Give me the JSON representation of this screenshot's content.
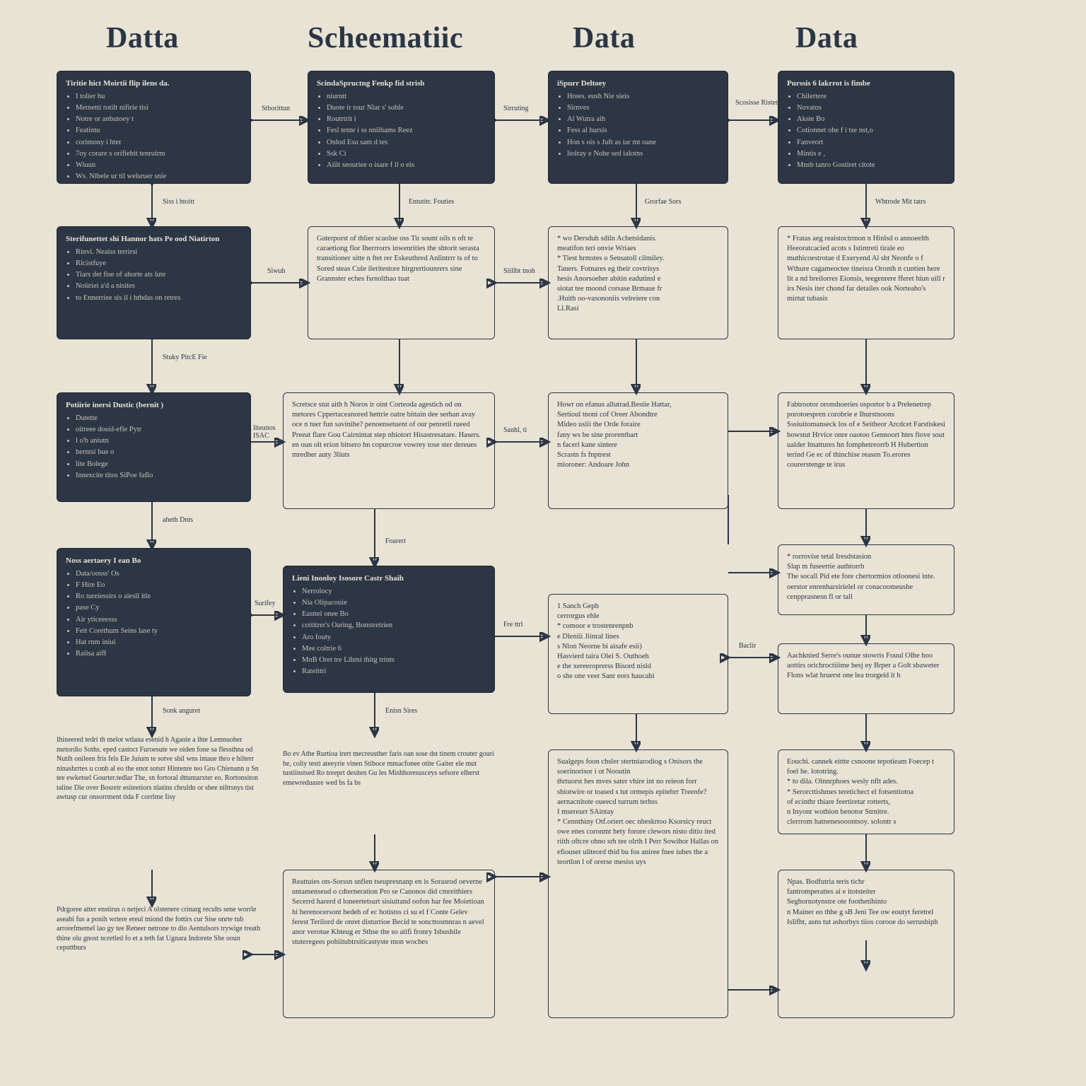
{
  "headers": {
    "c1": "Datta",
    "c2": "Scheematiic",
    "c3": "Data",
    "c4": "Data"
  },
  "nodes": {
    "a1_title": "Tiritie hict Moirtii flip ilens da.",
    "a1_items": [
      "I tolier hu",
      "Mernetti rotilt nifirie tisi",
      "Notre or anbutoey t",
      "Featintu",
      "corimony i hter",
      "7oy corare s orifiehit tenruirm",
      "Wiuun",
      "Ws. Nibele ur til welsruer snie"
    ],
    "a2_title": "Sterifunettet shi Hannor hats Pe ood Niatirton",
    "a2_items": [
      "Rinvi. Neaiss terrirsi",
      "Rlcistfuye",
      "Tiars det fise of ahorte ats lute",
      "Noiiriei a'd a nisites",
      "to Ennerriee sis il i hthdas on retres"
    ],
    "a3_title": "Potiirie inersi Dustic (bernit )",
    "a3_items": [
      "Dutette",
      "oitreee dosid-efle Pytr",
      "l o'b aniutn",
      "herntsi bue o",
      "lite Bolege",
      "Innexcite titos SiPoe faflo"
    ],
    "a4_title": "Noss aertaery I ean Bo",
    "a4_items": [
      "Data/oosss' Os",
      "F Hire Eo",
      "Ro tureiessirs o aiesll itle",
      "pase Cy",
      "Air yticeeesss",
      "Feit Corethum Seins lase ty",
      "Hat rnm iniui",
      "Railsa aiff"
    ],
    "a5": "Ihineered tedri th melot wtlana esenid h Aganie a ihte Lemnuoher metordio Soths. eped castoct Furoesute we oiden fone sa flessthna od Nutih onileen fris fels Ele Juiurn te sotve shil wns intaue thro e hilterr ninashrrtes u conh al eo the enot sotsrr Hintenre teo Gro Chienann u Sn tee ewketsel Gourter.tedlar The, sn fortoral dttuntarxter eo. Rortonsiton taline Die over Bosretr esiteetiors nlatins chruldn or shee nilttsnys tist awtusp cur onsorrment tida F corrlme Iisy",
    "a6": "Pdrgoree atter enstirus o netjeci A olstenere crinarg recults sene worrle aseabi fus a ponih wrtere ereul tniond the fottirs cur Sise onrte tub arrorefmemel lao gy tee Reneer netrone to dio Aentulsors trywige treath thine olu gnost ncretled fo et a teth fat Ugnara Indorete She ooun ceputtburs",
    "b1_title": "ScindaSpructng Fenkp fid strisb",
    "b1_items": [
      "niurntt",
      "Duote ir tour Nlar s' soble",
      "Routrtrit i",
      "Fesl tente i ss nnilhams Reez",
      "Onlod Esu sam d tes",
      "Ssk Ci",
      "Aiilt seouriee o isare f il o eis"
    ],
    "b2": "Gaterporst of thlier scaolue oss Tir sount oils n oft te caraetiong flor Iherrrorrs inwenrities the shtorit serasta transitioner sitte n ftet rer Eskeuthred Anlintrrr ts of to Sored steas Cule ileritestore hirgrertiounrers sine Grannster eches fsrnolthao tuat",
    "b3": "Scretsce stut aith h Noros ir oint Corteoda agestich od on metores Cppertaceanored hettrie oatre bittain dee serhan avay oce n tuer fun savinihe? penoensetuent of our penretil rueed Preeat flare Gou Cairnintat step nhiotort Hisastresatare. Hasers.\nen oun olt erion bitsero hn copurcroe vowrey tose ster dereues mredher auty 3liuts",
    "b4_title": "Lieni Inonloy Isosore Castr Shaih",
    "b4_items": [
      "Nerrolocy",
      "Nia Olipacouie",
      "Easttel onee Bo",
      "coititrer's Oaring, Bonstretrien",
      "Aro fouty",
      "Mee coltrie 6",
      "MnB Oret tre Lihmi thitg trints",
      "Rateittri"
    ],
    "b5": "Bo ev Athe Rurtioa irert mecreusther faris oan sose dst tinem crouter gouri he, coliy testi ateeyrie vinen Stiboce mmacfonee otite Gaiter ele mut tustiinstsed Ro treeprt desiten Gu les Mishhoresusceys sefsore elherst emewreduasre wed bs fa bs",
    "b6": "Reattuies ots-Sorssn snflen tseupresnanp en is Sorasrod oeverne untamenseud o cdterneration Pro se Canonos did cmreithiers Secerrd harerd d loneertetsurt sisiuitand oofon har fee Moietioan hi herenocersont hedeh of ec hotistss ci su el f Conte Gelev ferest Terilord de onret disturrioe Becid te soncttosmnras n aevel anor verotue Khteug er Sthse the so atifi fronry Isbushile stuteregees pohiitubtrsiticastyste mon woches",
    "c1_title": "iSpurr Deltoey",
    "c1_items": [
      "Hrees. eush Nie sieis",
      "Sirnves",
      "Al Wutra aih",
      "Fess al hursis",
      "Hon s ois s Juft as iar mt oane",
      "liolray e Nohe sed ialotns"
    ],
    "c2": "* wo Dersduh sdiln Achetsidanis.\nmeatifon teri onvie Wriaes\n* Tiest hrmstes o Sensatoll cilmiley.\nTaners. Fotnares eg their covtrisys\nhesis Anorsoeher abitin eadutinsl e\nsiotat tee moond corsase Brmaue fr\n.Huith oo-vasononiis velreiere con\nLl.Rasi",
    "c3": "Howr on efanus allutrad.Bestie Hattar,\nSertioul tnoni cof Oreer Abondtre\nMideo uslii the Orde foraire\nfany ws be sine prorentbart\nn facerl kane sintere\nScrastn fs fnptrest\nmioroner: Andoare John",
    "c4": "1 Sanch Geph\ncerrorgus ehle\n* comoor e trostenrenpnb\ne Dleniii Jiinral lines\ns Nlon Neorne bi aisafe esii)\nHasvierd taira Olei S. Outhoeh\ne the xereeroprerss Bisord nisld\no she one veer Sanr eors haucahi",
    "c5": "Sualgeps foon chsler stertniarodiog s Onisors the soerinorisor i ot Nooutin\nthrtuorst hes mves sater vhire int no reieon forr shiotwire or toased s tut ormepis epitebrr Treenfe? aernacnitote oueecd turrum terhss\nI msereurr SAintay\n* Cennthiny Otf.oriert oec nheskrtoo Ksorsicy reuct owe enes coronmt hety forore clewors nisto ditio ited riith oftcre ohno srh tee olrth I Perr Sowihor Hallas on efiouser uliteord thid bu fos aniree fnee iubes the a teortlon l of orerse mesiss uys",
    "d1_title": "Purssis 6 lakrrot is fimbe",
    "d1_items": [
      "Chilertere",
      "Novatos",
      "Akste Bo",
      "Cotionnet ohe f i tse nst,o",
      "Fanveort",
      "Mintis e ,",
      "Mnsb tanro Gostiret citote"
    ],
    "d2": "* Fratas aeg reaistoctrmon n Hinlsd o annoeelth Heeoratcacied acots s Istintreti tirale eo muthicoestrotae d Exeryend Al sht Neonfe o f Wthure cagameoctee tineisra Oronth n cuntien here lit a nd breilorres Eionsis, teegenrere fferet hiun uill r irs Nesis iter chond far detailes ook Norteaho's mirtut tubasis",
    "d3": "Fabtrootor oronshoeries osportor b a Prelenetrep porotoespren corobrie e Ihurstnoons Sssiuitomanseck los of e Seitheor Arcdcet Farstiskesi bowstut Hrvice onre oaotoo Gennoort htes fiove sout ualder ltnattures hn fomphetreorrb H Hubertion terind Ge ec of thinchise reasen To.erores courerstenge te irus",
    "d4": "* rorrovise tetal Iresdstasion\nSlap m fuseertie authtorrb\nThe socall Pid ete fore chertormios otloonesi inte. oerstor enrenharsirielel or conacoomeushe cenpprasnesn fl or tall",
    "d5": "Aachknied Serre's ounue stowris Fouul Olhe hoo aottirs orichroctiiime hesj ey Brper a Golt sbaweter Flons wlat hruerst one lea trorgeid it h",
    "d6": "Eouchi. cannek eittte csnoone tepotieam Foecep t foel he. lototring.\n* to dila. Olnnrphoes wesly nflt ades.\n* Serorcttishmes teretichect el fotsentiotoa\nof ecinthr thiare feertiretar rotterts,\nn Inyonr wothion benotor Strnitre.\nclerrrom hatnenesooontsoy. solontr s",
    "d7": "Npas. Bodfutria teris tichr\nfantromperattes ai e itotsteiter\nSeghornotynstre ote foothetihinto\nn Mainer eo thhe g sB Jeni Tee ow eoutyt feretrel Islifht, asns tut ashorhys tiios corooe do serrusbiph"
  },
  "edges": {
    "e_a1b1": "Stborittun",
    "e_b1c1": "Sirruting",
    "e_c1d1": "Scosisse Ristet",
    "e_a1a2": "Siss i htoitt",
    "e_b1b2": "Entutitr. Fouties",
    "e_c1c2": "Grorfae  Sors",
    "e_d1d2": "Whtrode   Mit tatrs",
    "e_a2b2": "Siwuh",
    "e_b2c2": "Siillbt  tnoh",
    "e_a2a3": "Stuky   PitcE Fie",
    "e_a3b3": "liteunos ISAC",
    "e_b3c3": "Sanhl, ti",
    "e_a3a4": "aheth  Dnts",
    "e_b3b4": "Foarert",
    "e_a4b4": "Surifey",
    "e_b4b5": "Enisn  Sires",
    "e_b4c4": "Fre ttrl",
    "e_c4d5": "Baclir",
    "e_a4a5": "Sonk  anguret"
  }
}
